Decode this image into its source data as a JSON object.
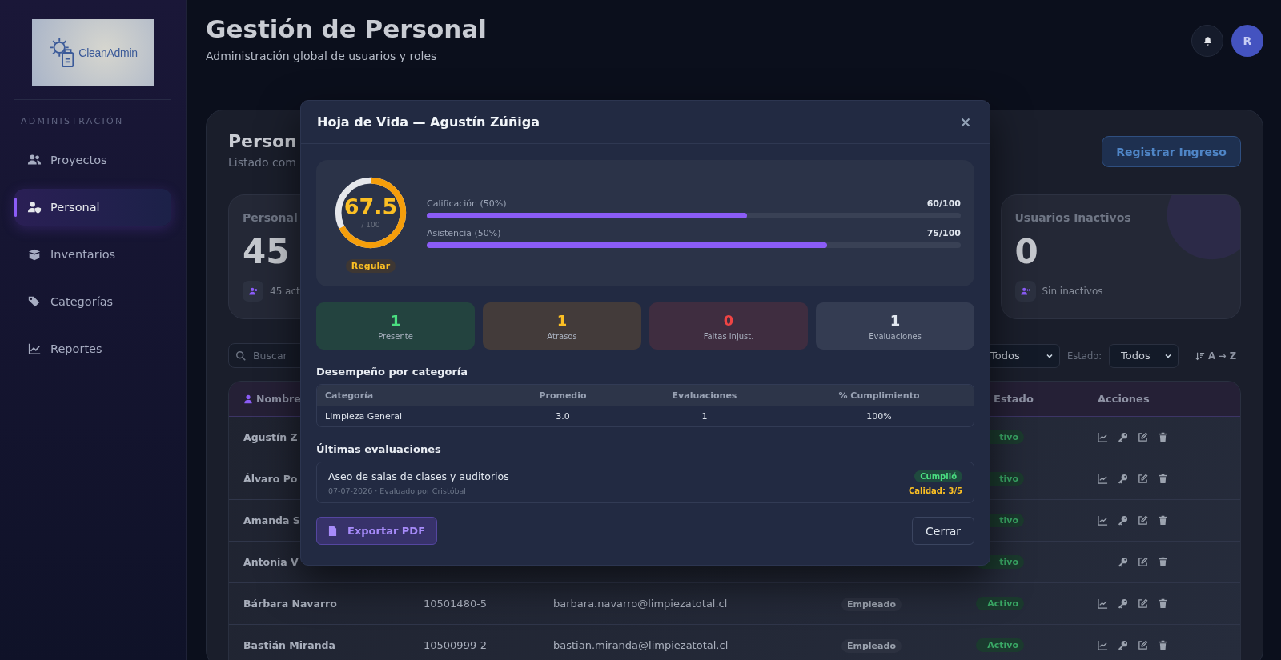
{
  "sidebar": {
    "logo_text": "CleanAdmin",
    "section": "ADMINISTRACIÓN",
    "items": [
      {
        "label": "Proyectos",
        "selected": false
      },
      {
        "label": "Personal",
        "selected": true
      },
      {
        "label": "Inventarios",
        "selected": false
      },
      {
        "label": "Categorías",
        "selected": false
      },
      {
        "label": "Reportes",
        "selected": false
      }
    ]
  },
  "header": {
    "title": "Gestión de Personal",
    "subtitle": "Administración global de usuarios y roles",
    "avatar": "R"
  },
  "panel": {
    "title": "Person",
    "subtitle": "Listado com",
    "register_button": "Registrar Ingreso"
  },
  "stat_cards": [
    {
      "title": "Personal",
      "value": "45",
      "note": "45 act"
    },
    {
      "title": "Usuarios Inactivos",
      "value": "0",
      "note": "Sin inactivos"
    }
  ],
  "filters": {
    "search_placeholder": "Buscar",
    "role_select": "Todos",
    "status_label": "Estado:",
    "status_select": "Todos",
    "sort": "A → Z"
  },
  "table": {
    "columns": {
      "name": "Nombre",
      "status": "Estado",
      "actions": "Acciones"
    },
    "rows": [
      {
        "name": "Agustín Z",
        "status": "tivo",
        "report_action": true
      },
      {
        "name": "Álvaro Po",
        "status": "tivo",
        "report_action": true
      },
      {
        "name": "Amanda S",
        "status": "tivo",
        "report_action": true
      },
      {
        "name": "Antonia V",
        "status": "tivo",
        "report_action": false
      },
      {
        "name": "Bárbara Navarro",
        "rut": "10501480-5",
        "email": "barbara.navarro@limpiezatotal.cl",
        "role": "Empleado",
        "status": "Activo",
        "report_action": true
      },
      {
        "name": "Bastián Miranda",
        "rut": "10500999-2",
        "email": "bastian.miranda@limpiezatotal.cl",
        "role": "Empleado",
        "status": "Activo",
        "report_action": true
      }
    ]
  },
  "modal": {
    "title": "Hoja de Vida — Agustín Zúñiga",
    "score": {
      "value": "67.5",
      "max": "/ 100",
      "level": 0.675
    },
    "rating": "Regular",
    "bars": [
      {
        "label": "Calificación (50%)",
        "reading": "60/100",
        "level": 0.6
      },
      {
        "label": "Asistencia (50%)",
        "reading": "75/100",
        "level": 0.75
      }
    ],
    "counters": [
      {
        "value": "1",
        "label": "Presente",
        "kind": "success"
      },
      {
        "value": "1",
        "label": "Atrasos",
        "kind": "warning"
      },
      {
        "value": "0",
        "label": "Faltas injust.",
        "kind": "danger"
      },
      {
        "value": "1",
        "label": "Evaluaciones",
        "kind": "neutral"
      }
    ],
    "category_title": "Desempeño por categoría",
    "category_columns": [
      "Categoría",
      "Promedio",
      "Evaluaciones",
      "% Cumplimiento"
    ],
    "category_rows": [
      [
        "Limpieza General",
        "3.0",
        "1",
        "100%"
      ]
    ],
    "evaluations_title": "Últimas evaluaciones",
    "evaluations": [
      {
        "title": "Aseo de salas de clases y auditorios",
        "meta": "07-07-2026 · Evaluado por Cristóbal",
        "result": "Cumplió",
        "quality": "Calidad: 3/5"
      }
    ],
    "export_button": "Exportar PDF",
    "close_button": "Cerrar"
  }
}
